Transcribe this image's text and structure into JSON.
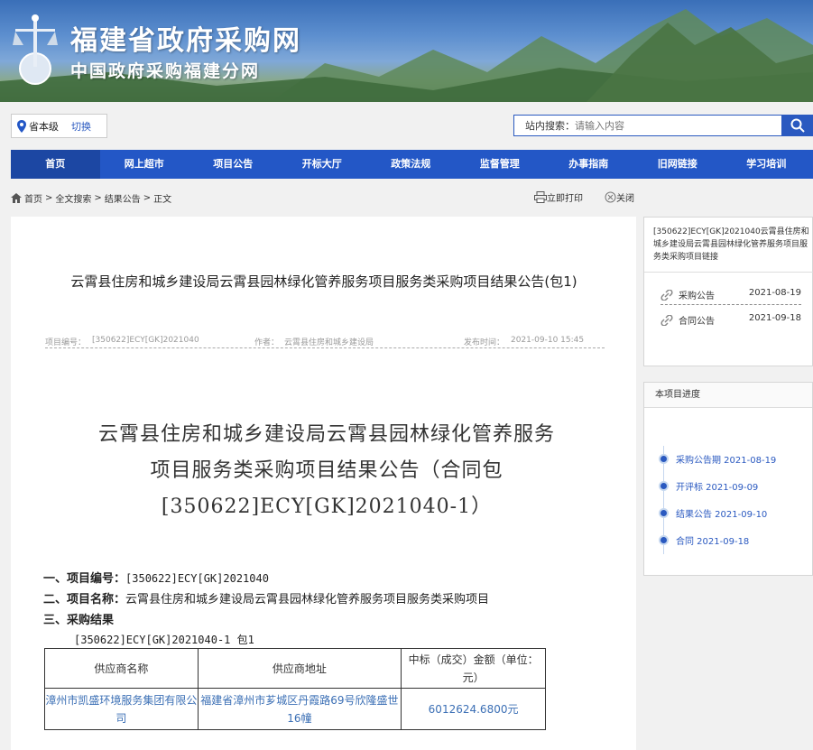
{
  "banner": {
    "title": "福建省政府采购网",
    "subtitle": "中国政府采购福建分网"
  },
  "region": {
    "name": "省本级",
    "switch_label": "切换"
  },
  "search": {
    "label": "站内搜索：",
    "placeholder": "请输入内容"
  },
  "nav": [
    "首页",
    "网上超市",
    "项目公告",
    "开标大厅",
    "政策法规",
    "监督管理",
    "办事指南",
    "旧网链接",
    "学习培训"
  ],
  "breadcrumb": {
    "items": [
      "首页",
      "全文搜索",
      "结果公告",
      "正文"
    ],
    "sep": ">",
    "print": "立即打印",
    "close": "关闭"
  },
  "doc": {
    "title": "云霄县住房和城乡建设局云霄县园林绿化管养服务项目服务类采购项目结果公告(包1)",
    "meta": {
      "code_label": "项目编号：",
      "code": "[350622]ECY[GK]2021040",
      "author_label": "作者：",
      "author": "云霄县住房和城乡建设局",
      "date_label": "发布时间：",
      "date": "2021-09-10 15:45"
    },
    "body_title_lines": [
      "云霄县住房和城乡建设局云霄县园林绿化管养服务",
      "项目服务类采购项目结果公告（合同包",
      "[350622]ECY[GK]2021040-1）"
    ],
    "section1_label": "一、项目编号：",
    "section1_value": "[350622]ECY[GK]2021040",
    "section2_label": "二、项目名称：",
    "section2_value": "云霄县住房和城乡建设局云霄县园林绿化管养服务项目服务类采购项目",
    "section3_label": "三、采购结果",
    "package_line": "[350622]ECY[GK]2021040-1 包1",
    "table": {
      "headers": [
        "供应商名称",
        "供应商地址",
        "中标（成交）金额（单位：元）"
      ],
      "rows": [
        [
          "漳州市凯盛环境服务集团有限公司",
          "福建省漳州市芗城区丹霞路69号欣隆盛世16幢",
          "6012624.6800元"
        ]
      ]
    }
  },
  "sidebar": {
    "project_title": "[350622]ECY[GK]2021040云霄县住房和城乡建设局云霄县园林绿化管养服务项目服务类采购项目链接",
    "links": [
      {
        "label": "采购公告",
        "date": "2021-08-19"
      },
      {
        "label": "合同公告",
        "date": "2021-09-18"
      }
    ],
    "progress_title": "本项目进度",
    "progress": [
      {
        "text": "采购公告期 2021-08-19"
      },
      {
        "text": "开评标 2021-09-09"
      },
      {
        "text": "结果公告 2021-09-10"
      },
      {
        "text": "合同 2021-09-18"
      }
    ]
  },
  "colors": {
    "brand_blue": "#2357c6",
    "link_blue": "#3b6fb5"
  }
}
